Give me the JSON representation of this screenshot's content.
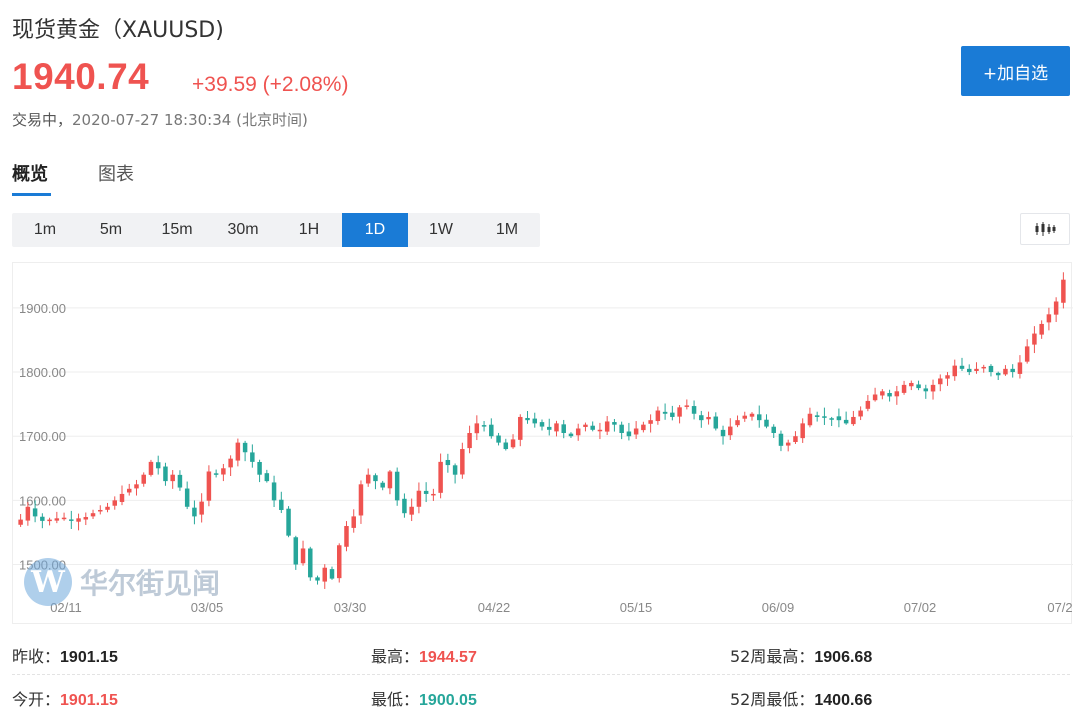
{
  "header": {
    "title": "现货黄金（XAUUSD)",
    "price": "1940.74",
    "change": "+39.59 (+2.08%)",
    "status": "交易中，",
    "timestamp": "2020-07-27 18:30:34 (北京时间)",
    "watch_button": "+加自选"
  },
  "tabs": [
    {
      "label": "概览",
      "active": true
    },
    {
      "label": "图表",
      "active": false
    }
  ],
  "periods": [
    {
      "label": "1m",
      "active": false
    },
    {
      "label": "5m",
      "active": false
    },
    {
      "label": "15m",
      "active": false
    },
    {
      "label": "30m",
      "active": false
    },
    {
      "label": "1H",
      "active": false
    },
    {
      "label": "1D",
      "active": true
    },
    {
      "label": "1W",
      "active": false
    },
    {
      "label": "1M",
      "active": false
    }
  ],
  "colors": {
    "up": "#ef5350",
    "down": "#26a69a",
    "accent": "#1a7bd6"
  },
  "watermark": {
    "logo": "W",
    "text": "华尔街见闻"
  },
  "chart_data": {
    "type": "candlestick",
    "y_ticks": [
      "1500.00",
      "1600.00",
      "1700.00",
      "1800.00",
      "1900.00"
    ],
    "x_ticks": [
      "02/11",
      "03/05",
      "03/30",
      "04/22",
      "05/15",
      "06/09",
      "07/02",
      "07/2"
    ],
    "ylim": [
      1440,
      1970
    ],
    "grid": "horizontal",
    "closes": [
      1570,
      1590,
      1575,
      1568,
      1570,
      1572,
      1573,
      1569,
      1572,
      1574,
      1580,
      1585,
      1590,
      1600,
      1610,
      1618,
      1625,
      1640,
      1660,
      1650,
      1630,
      1640,
      1620,
      1590,
      1575,
      1598,
      1645,
      1642,
      1650,
      1665,
      1690,
      1675,
      1660,
      1640,
      1630,
      1600,
      1585,
      1545,
      1500,
      1525,
      1480,
      1475,
      1495,
      1478,
      1530,
      1560,
      1575,
      1625,
      1640,
      1630,
      1620,
      1645,
      1600,
      1580,
      1590,
      1615,
      1610,
      1610,
      1660,
      1655,
      1640,
      1680,
      1705,
      1720,
      1715,
      1700,
      1690,
      1680,
      1695,
      1730,
      1725,
      1720,
      1715,
      1710,
      1720,
      1705,
      1700,
      1712,
      1718,
      1710,
      1710,
      1723,
      1718,
      1705,
      1700,
      1712,
      1718,
      1725,
      1740,
      1735,
      1730,
      1745,
      1748,
      1735,
      1725,
      1730,
      1712,
      1700,
      1715,
      1725,
      1732,
      1735,
      1725,
      1715,
      1705,
      1685,
      1690,
      1700,
      1720,
      1735,
      1730,
      1730,
      1728,
      1725,
      1720,
      1730,
      1740,
      1755,
      1765,
      1770,
      1762,
      1770,
      1780,
      1783,
      1775,
      1770,
      1780,
      1790,
      1795,
      1810,
      1805,
      1800,
      1805,
      1808,
      1800,
      1795,
      1805,
      1800,
      1815,
      1840,
      1860,
      1875,
      1890,
      1910,
      1944
    ]
  }
}
